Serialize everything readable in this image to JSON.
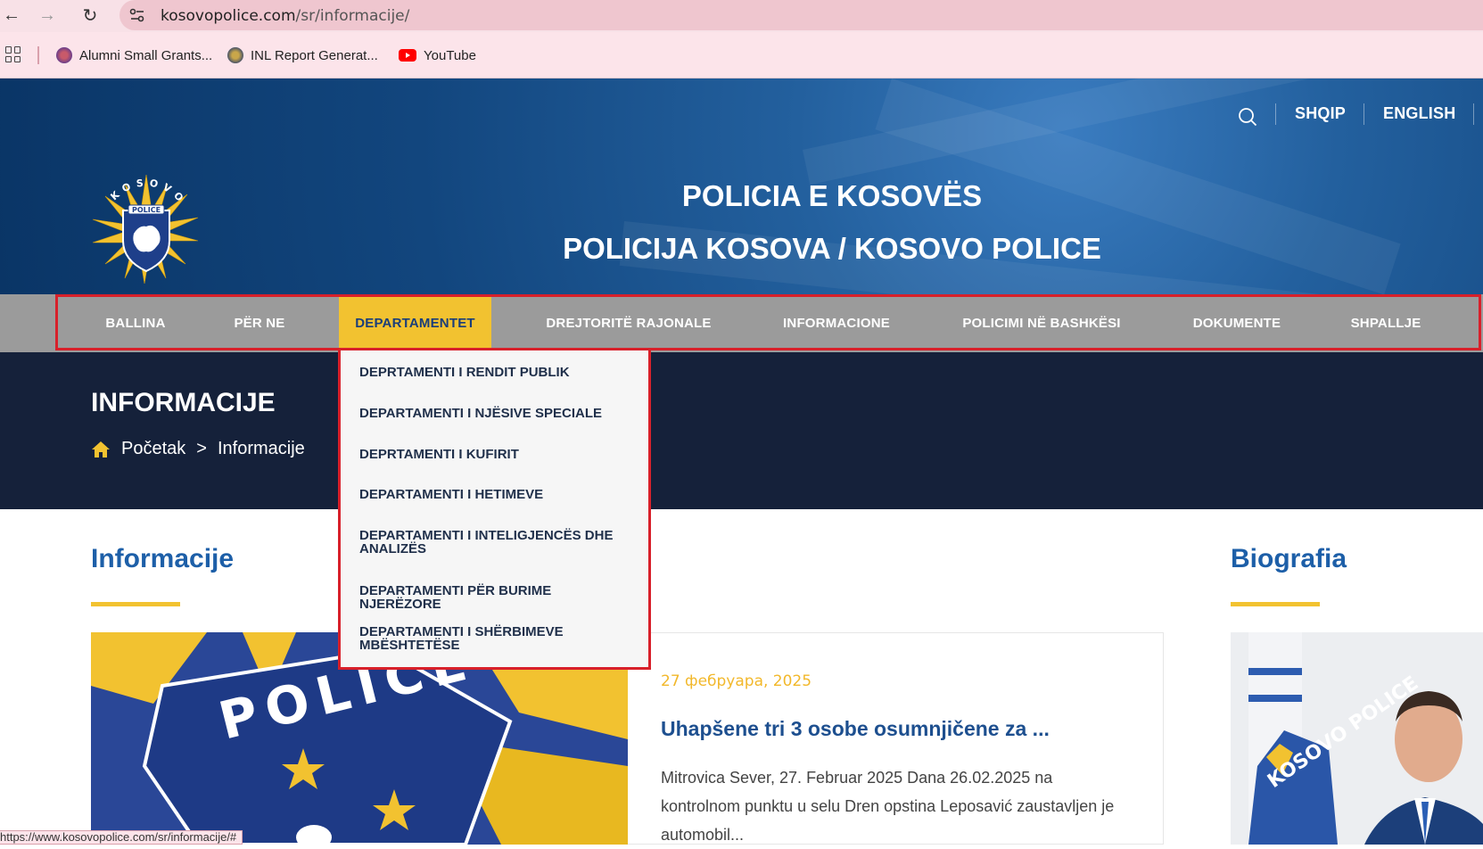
{
  "browser": {
    "url_domain": "kosovopolice.com",
    "url_path": "/sr/informacije/",
    "bookmarks": [
      {
        "label": "Alumni Small Grants..."
      },
      {
        "label": "INL Report Generat..."
      },
      {
        "label": "YouTube"
      }
    ],
    "status_url": "https://www.kosovopolice.com/sr/informacije/#"
  },
  "header": {
    "languages": [
      "SHQIP",
      "ENGLISH"
    ],
    "logo_text_top": "KOSOVO",
    "logo_text_banner": "POLICE",
    "title_line1": "POLICIA E KOSOVËS",
    "title_line2": "POLICIJA KOSOVA / KOSOVO POLICE"
  },
  "nav": {
    "items": [
      {
        "label": "BALLINA"
      },
      {
        "label": "PËR NE"
      },
      {
        "label": "DEPARTAMENTET"
      },
      {
        "label": "DREJTORITË RAJONALE"
      },
      {
        "label": "INFORMACIONE"
      },
      {
        "label": "POLICIMI NË BASHKËSI"
      },
      {
        "label": "DOKUMENTE"
      },
      {
        "label": "SHPALLJE"
      }
    ],
    "active_index": 2
  },
  "dropdown": {
    "items": [
      {
        "label": "DEPRTAMENTI I RENDIT PUBLIK"
      },
      {
        "label": "DEPARTAMENTI I NJËSIVE SPECIALE"
      },
      {
        "label": "DEPRTAMENTI I KUFIRIT"
      },
      {
        "label": "DEPARTAMENTI I HETIMEVE"
      },
      {
        "label": "DEPARTAMENTI I INTELIGJENCËS DHE ANALIZËS"
      },
      {
        "label": "DEPARTAMENTI PËR BURIME NJERËZORE"
      },
      {
        "label": "DEPARTAMENTI I SHËRBIMEVE MBËSHTETËSE"
      }
    ]
  },
  "banner": {
    "title": "INFORMACIJE",
    "breadcrumb_home": "Početak",
    "breadcrumb_sep": ">",
    "breadcrumb_current": "Informacije"
  },
  "content": {
    "section_title": "Informacije",
    "news": {
      "image_text": "POLICE",
      "date": "27 фебруара, 2025",
      "title": "Uhapšene tri 3 osobe osumnjičene za ...",
      "text": "Mitrovica Sever, 27. Februar 2025 Dana 26.02.2025 na kontrolnom punktu u selu Dren opstina Leposavić zaustavljen je automobil..."
    },
    "sidebar_title": "Biografia",
    "bio_badge_text": "KOSOVO POLICE"
  },
  "colors": {
    "accent_yellow": "#f2c230",
    "brand_blue": "#1d5fa8",
    "nav_gray": "#9b9b9b",
    "banner_dark": "#15213a",
    "highlight_red": "#d8202a"
  }
}
